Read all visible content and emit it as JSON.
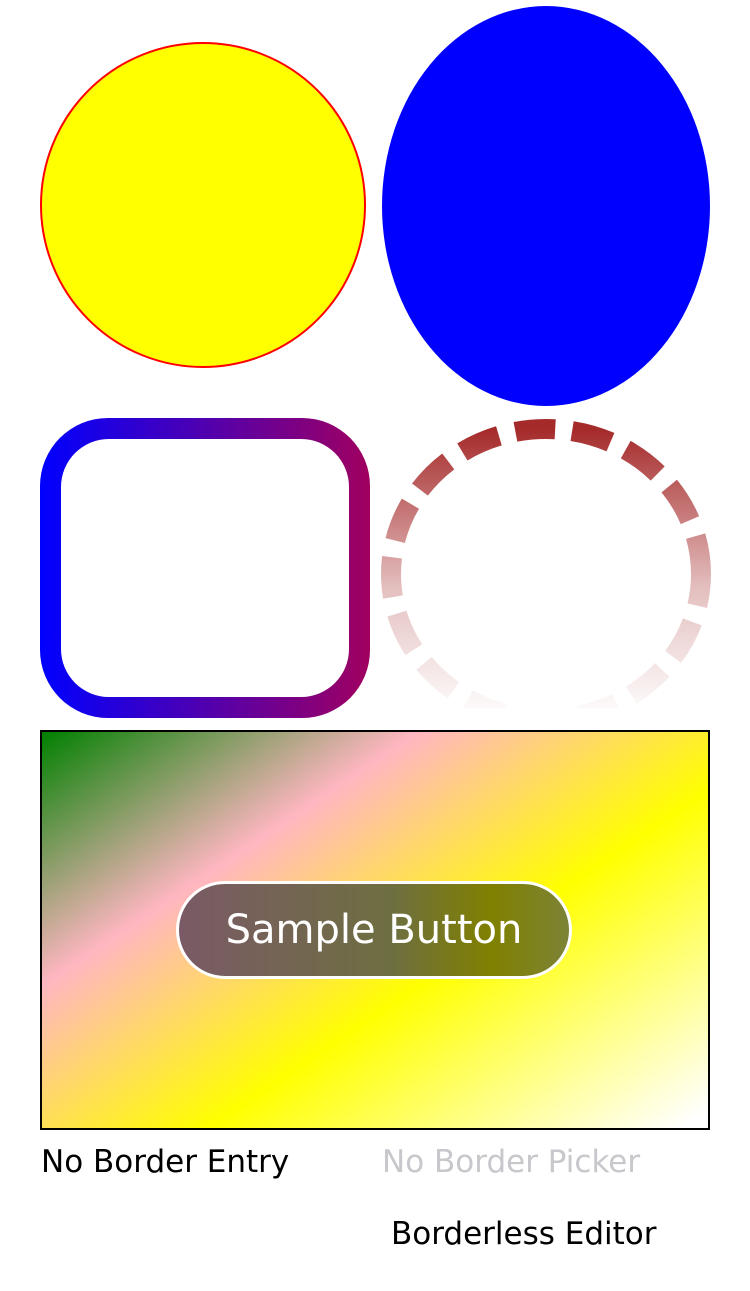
{
  "shapes": {
    "yellow_circle": {
      "fill": "#ffff00",
      "stroke": "#ff0000"
    },
    "blue_ellipse": {
      "fill": "#0000ff"
    },
    "gradient_frame": {
      "gradient_start": "#0000ff",
      "gradient_end": "#a0005f"
    },
    "dashed_ring": {
      "color": "#a52a2a"
    }
  },
  "panel": {
    "gradient_stops": [
      "#008000",
      "#ffb6c1",
      "#ffff00",
      "#ffffff"
    ],
    "border_color": "#000000",
    "button": {
      "label": "Sample Button",
      "border_color": "#ffffff",
      "text_color": "#ffffff"
    }
  },
  "fields": {
    "entry_text": "No Border Entry",
    "picker_placeholder": "No Border Picker",
    "editor_text": "Borderless Editor"
  }
}
